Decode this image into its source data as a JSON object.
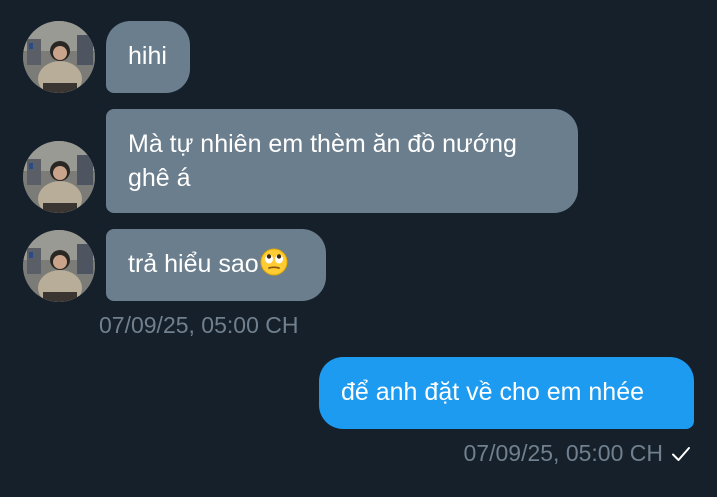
{
  "conversation": {
    "incoming": [
      {
        "text": "hihi"
      },
      {
        "text_line1": "Mà tự nhiên em thèm ăn đồ nướng",
        "text_line2": "ghê á"
      },
      {
        "text": "trả hiểu sao"
      }
    ],
    "incoming_timestamp": "07/09/25, 05:00 CH",
    "outgoing": [
      {
        "text": "để anh đặt về cho em nhée"
      }
    ],
    "outgoing_timestamp": "07/09/25, 05:00 CH"
  },
  "icons": {
    "emoji": "face-with-rolling-eyes-icon",
    "read_status": "checkmark-icon"
  },
  "colors": {
    "background": "#15202b",
    "incoming_bubble": "#6b7e8d",
    "outgoing_bubble": "#1d9bf0",
    "timestamp": "#71808e"
  }
}
